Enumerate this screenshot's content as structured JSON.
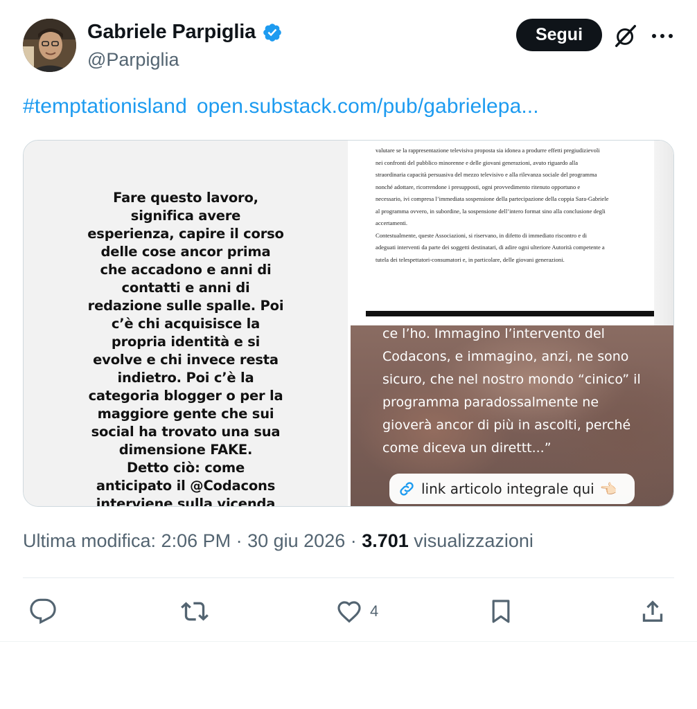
{
  "author": {
    "name": "Gabriele Parpiglia",
    "handle": "@Parpiglia",
    "verified_icon": "verified-badge-icon"
  },
  "header_actions": {
    "follow_label": "Segui",
    "grok_icon": "grok-icon",
    "more_icon": "more-options-icon"
  },
  "tweet": {
    "hashtag": "#temptationisland",
    "link": "open.substack.com/pub/gabrielepa..."
  },
  "media": {
    "story_text": "Fare questo lavoro,\nsignifica avere\nesperienza, capire il corso\ndelle cose ancor prima\nche accadono e anni di\ncontatti e anni di\nredazione sulle spalle. Poi\nc’è chi acquisisce la\npropria identità e si\nevolve e chi invece resta\nindietro. Poi c’è la\ncategoria blogger o per la\nmaggiore gente che sui\nsocial ha trovato una sua\ndimensione FAKE.\nDetto ciò: come\nanticipato il @Codacons\ninterviene sulla vicenda",
    "document_text": "valutare se la rappresentazione televisiva proposta sia idonea a produrre effetti pregiudizievoli\nnei confronti del pubblico minorenne e delle giovani generazioni, avuto riguardo alla\nstraordinaria capacità persuasiva del mezzo televisivo e alla rilevanza sociale del programma\nnonché adottare, ricorrendone i presupposti, ogni provvedimento ritenuto opportuno e\nnecessario, ivi compresa l’immediata sospensione della partecipazione della coppia Sara-Gabriele\nal programma ovvero, in subordine, la sospensione dell’intero format sino alla conclusione degli\naccertamenti.\nContestualmente, queste Associazioni, si riservano, in difetto di immediato riscontro e di\nadeguati interventi da parte dei soggetti destinatari, di adire ogni ulteriore Autorità competente a\ntutela dei telespettatori-consumatori e, in particolare, delle giovani generazioni.",
    "photo_text": "ce l’ho. Immagino l’intervento del\nCodacons, e immagino, anzi, ne sono\nsicuro, che nel nostro mondo “cinico” il\nprogramma paradossalmente ne\ngioverà ancor di più in ascolti, perché\ncome diceva un direttt...”",
    "link_chip_label": "link articolo integrale qui",
    "link_chip_hand": "👈🏻"
  },
  "meta": {
    "edited_prefix": "Ultima modifica: 2:06 PM · 30 giu 2026 · ",
    "views_count": "3.701",
    "views_label": " visualizzazioni"
  },
  "actions": {
    "reply_icon": "reply-icon",
    "retweet_icon": "retweet-icon",
    "like_icon": "like-icon",
    "like_count": "4",
    "bookmark_icon": "bookmark-icon",
    "share_icon": "share-icon"
  },
  "colors": {
    "accent": "#1d9bf0",
    "text_primary": "#0f1419",
    "text_secondary": "#536471",
    "button_dark": "#0f1419"
  }
}
